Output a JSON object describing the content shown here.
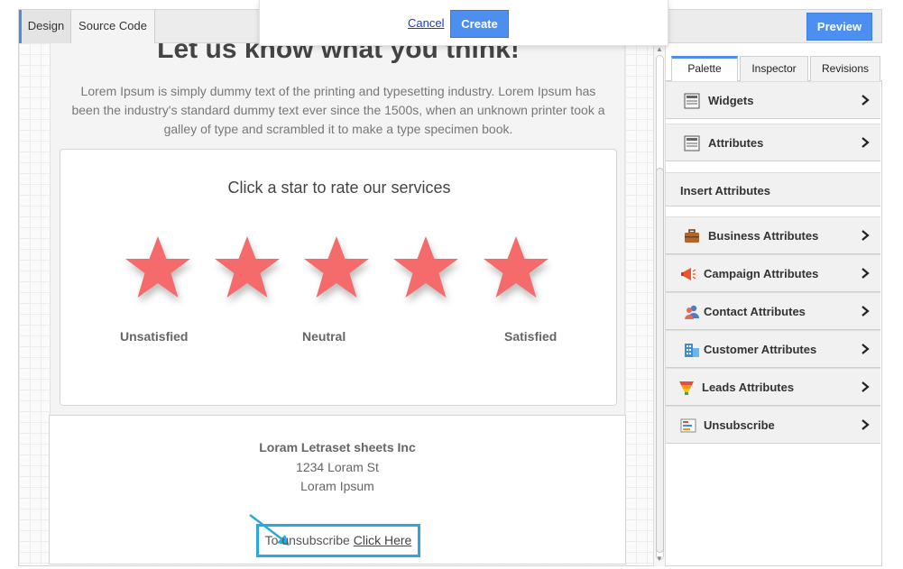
{
  "toolbar": {
    "design_tab": "Design",
    "source_code_tab": "Source Code",
    "preview_label": "Preview"
  },
  "modal": {
    "cancel_label": "Cancel",
    "create_label": "Create"
  },
  "hero": {
    "title": "Let us know what you think!",
    "description": "Lorem Ipsum is simply dummy text of the printing and typesetting industry. Lorem Ipsum has been the industry's standard dummy text ever since the 1500s, when an unknown printer took a galley of type and scrambled it to make a type specimen book."
  },
  "rating": {
    "prompt": "Click a star to rate our services",
    "star_count": 5,
    "star_color": "#f56b6b",
    "labels": {
      "low": "Unsatisfied",
      "mid": "Neutral",
      "high": "Satisfied"
    }
  },
  "footer": {
    "company": "Loram Letraset sheets Inc",
    "address_line1": "1234 Loram St",
    "address_line2": "Loram Ipsum",
    "unsubscribe_prefix": "To unsubscribe",
    "unsubscribe_link": "Click Here",
    "highlight_color": "#29a9df"
  },
  "panel": {
    "tabs": [
      "Palette",
      "Inspector",
      "Revisions"
    ],
    "active_tab": "Palette",
    "sections": [
      {
        "label": "Widgets",
        "icon": "widgets-icon"
      },
      {
        "label": "Attributes",
        "icon": "attributes-icon"
      }
    ],
    "insert_header": "Insert Attributes",
    "attributes": [
      {
        "label": "Business Attributes",
        "icon": "briefcase-icon"
      },
      {
        "label": "Campaign Attributes",
        "icon": "megaphone-icon"
      },
      {
        "label": "Contact Attributes",
        "icon": "contacts-icon"
      },
      {
        "label": "Customer Attributes",
        "icon": "building-icon"
      },
      {
        "label": "Leads Attributes",
        "icon": "funnel-icon"
      },
      {
        "label": "Unsubscribe",
        "icon": "unsubscribe-icon"
      }
    ]
  },
  "colors": {
    "accent": "#4d8ff0",
    "star": "#f56b6b"
  }
}
